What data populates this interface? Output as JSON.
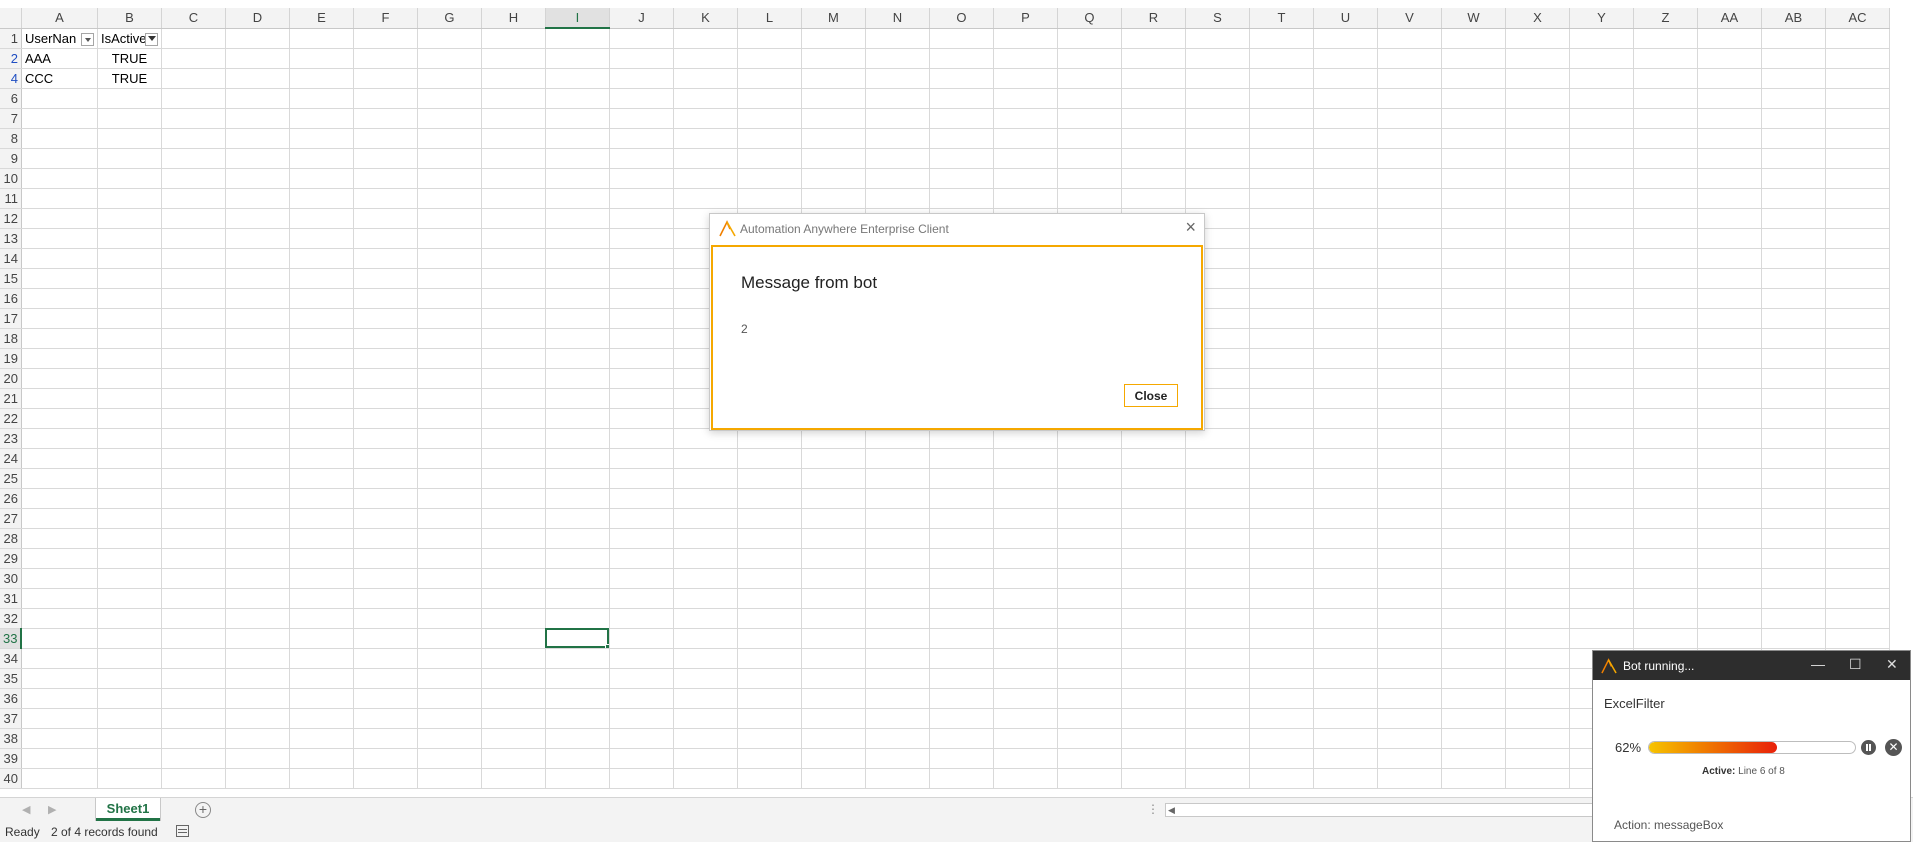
{
  "sheet": {
    "columns": [
      "A",
      "B",
      "C",
      "D",
      "E",
      "F",
      "G",
      "H",
      "I",
      "J",
      "K",
      "L",
      "M",
      "N",
      "O",
      "P",
      "Q",
      "R",
      "S",
      "T",
      "U",
      "V",
      "W",
      "X",
      "Y",
      "Z",
      "AA",
      "AB",
      "AC"
    ],
    "selected_column": "I",
    "rows": [
      {
        "num": "1",
        "cells": [
          "UserNan",
          "IsActive"
        ],
        "header": true
      },
      {
        "num": "2",
        "cells": [
          "AAA",
          "TRUE"
        ]
      },
      {
        "num": "4",
        "cells": [
          "CCC",
          "TRUE"
        ]
      },
      {
        "num": "6"
      },
      {
        "num": "7"
      },
      {
        "num": "8"
      },
      {
        "num": "9"
      },
      {
        "num": "10"
      },
      {
        "num": "11"
      },
      {
        "num": "12"
      },
      {
        "num": "13"
      },
      {
        "num": "14"
      },
      {
        "num": "15"
      },
      {
        "num": "16"
      },
      {
        "num": "17"
      },
      {
        "num": "18"
      },
      {
        "num": "19"
      },
      {
        "num": "20"
      },
      {
        "num": "21"
      },
      {
        "num": "22"
      },
      {
        "num": "23"
      },
      {
        "num": "24"
      },
      {
        "num": "25"
      },
      {
        "num": "26"
      },
      {
        "num": "27"
      },
      {
        "num": "28"
      },
      {
        "num": "29"
      },
      {
        "num": "30"
      },
      {
        "num": "31"
      },
      {
        "num": "32"
      },
      {
        "num": "33"
      },
      {
        "num": "34"
      },
      {
        "num": "35"
      },
      {
        "num": "36"
      },
      {
        "num": "37"
      },
      {
        "num": "38"
      },
      {
        "num": "39"
      },
      {
        "num": "40"
      }
    ],
    "selected_row": "33",
    "filtered_rows": [
      "2",
      "4"
    ]
  },
  "tabs": {
    "sheet_name": "Sheet1",
    "add_sheet_icon": "+"
  },
  "status": {
    "ready": "Ready",
    "records": "2 of 4 records found"
  },
  "dialog": {
    "title": "Automation Anywhere Enterprise Client",
    "heading": "Message from bot",
    "message": "2",
    "close_button": "Close",
    "close_icon": "×",
    "accent": "#f5a800"
  },
  "bot_panel": {
    "title": "Bot running...",
    "bot_name": "ExcelFilter",
    "progress_label": "62%",
    "progress": 0.62,
    "status_label": "Active:",
    "status_value": "Line 6 of 8",
    "action_label": "Action:",
    "action_value": "messageBox",
    "minimize_icon": "—",
    "maximize_icon": "☐",
    "close_icon": "✕",
    "stop_icon": "✕"
  },
  "colors": {
    "excel_green": "#217346",
    "filter_blue": "#1f4ec2",
    "brand_orange": "#f08000"
  }
}
